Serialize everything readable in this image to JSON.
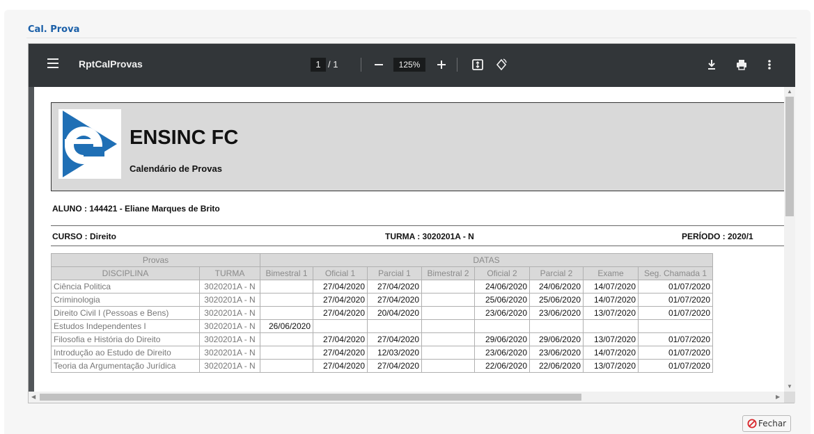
{
  "dialog": {
    "title": "Cal. Prova",
    "close_label": "Fechar"
  },
  "pdf_toolbar": {
    "doc_name": "RptCalProvas",
    "page_current": "1",
    "page_total": "/ 1",
    "zoom": "125%",
    "icons": [
      "menu-icon",
      "zoom-out-icon",
      "zoom-in-icon",
      "fit-page-icon",
      "rotate-icon",
      "download-icon",
      "print-icon",
      "more-icon"
    ]
  },
  "report": {
    "org_name": "ENSINC FC",
    "subtitle": "Calendário de Provas",
    "aluno": "ALUNO : 144421 - Eliane Marques de Brito",
    "curso": "CURSO : Direito",
    "turma": "TURMA : 3020201A - N",
    "periodo": "PERÍODO : 2020/1",
    "group_headers": [
      "Provas",
      "DATAS"
    ],
    "columns": [
      "DISCIPLINA",
      "TURMA",
      "Bimestral 1",
      "Oficial 1",
      "Parcial 1",
      "Bimestral 2",
      "Oficial 2",
      "Parcial 2",
      "Exame",
      "Seg. Chamada 1"
    ],
    "rows": [
      [
        "Ciência Politica",
        "3020201A - N",
        "",
        "27/04/2020",
        "27/04/2020",
        "",
        "24/06/2020",
        "24/06/2020",
        "14/07/2020",
        "01/07/2020"
      ],
      [
        "Criminologia",
        "3020201A - N",
        "",
        "27/04/2020",
        "27/04/2020",
        "",
        "25/06/2020",
        "25/06/2020",
        "14/07/2020",
        "01/07/2020"
      ],
      [
        "Direito Civil I (Pessoas e Bens)",
        "3020201A - N",
        "",
        "27/04/2020",
        "20/04/2020",
        "",
        "23/06/2020",
        "23/06/2020",
        "13/07/2020",
        "01/07/2020"
      ],
      [
        "Estudos Independentes I",
        "3020201A - N",
        "26/06/2020",
        "",
        "",
        "",
        "",
        "",
        "",
        ""
      ],
      [
        "Filosofia e História do Direito",
        "3020201A - N",
        "",
        "27/04/2020",
        "27/04/2020",
        "",
        "29/06/2020",
        "29/06/2020",
        "13/07/2020",
        "01/07/2020"
      ],
      [
        "Introdução ao Estudo de Direito",
        "3020201A - N",
        "",
        "27/04/2020",
        "12/03/2020",
        "",
        "23/06/2020",
        "23/06/2020",
        "14/07/2020",
        "01/07/2020"
      ],
      [
        "Teoria da Argumentação Jurídica",
        "3020201A - N",
        "",
        "27/04/2020",
        "27/04/2020",
        "",
        "22/06/2020",
        "22/06/2020",
        "13/07/2020",
        "01/07/2020"
      ]
    ]
  },
  "colors": {
    "title_blue": "#1a5fa8",
    "toolbar": "#323639",
    "viewer_bg": "#525659",
    "logo_blue": "#1f6fb5",
    "header_gray": "#d9d9d9",
    "close_red": "#d9262b"
  }
}
